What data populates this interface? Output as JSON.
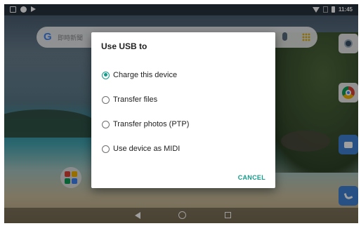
{
  "status_bar": {
    "time": "11:45",
    "left_icons": [
      "gallery-notification-icon",
      "circle-notification-icon",
      "flag-notification-icon"
    ],
    "right_icons": [
      "wifi-icon",
      "no-sim-icon",
      "battery-icon"
    ]
  },
  "search_bar": {
    "logo": "G",
    "placeholder": "即時新聞"
  },
  "dock": [
    "camera-icon",
    "chrome-icon",
    "messages-icon",
    "phone-icon"
  ],
  "dialog": {
    "title": "Use USB to",
    "options": [
      {
        "label": "Charge this device",
        "selected": true
      },
      {
        "label": "Transfer files",
        "selected": false
      },
      {
        "label": "Transfer photos (PTP)",
        "selected": false
      },
      {
        "label": "Use device as MIDI",
        "selected": false
      }
    ],
    "cancel_label": "CANCEL"
  },
  "colors": {
    "accent": "#159a8a",
    "dialog_bg": "#ffffff",
    "text": "#212121"
  },
  "navigation": [
    "back-icon",
    "home-icon",
    "recents-icon"
  ]
}
